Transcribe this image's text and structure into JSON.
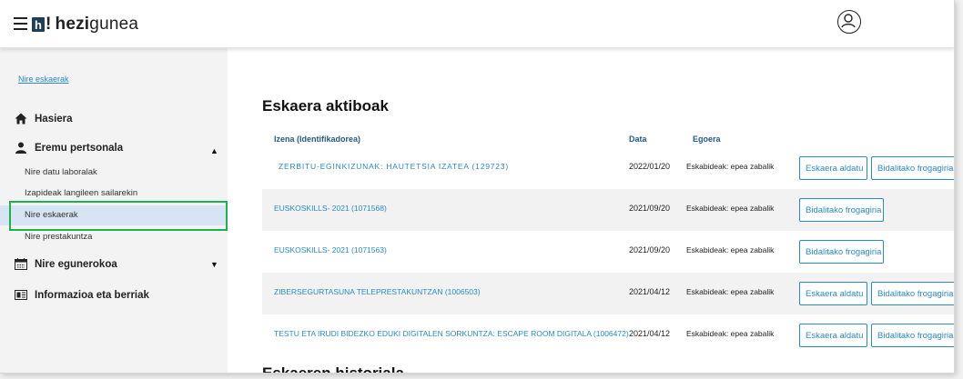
{
  "header": {
    "logo_box": "h",
    "logo_bang": "!",
    "logo_bold": "hezi",
    "logo_light": "gunea"
  },
  "sidebar": {
    "breadcrumb": "Nire eskaerak",
    "home": "Hasiera",
    "personal": "Eremu pertsonala",
    "sub_items": [
      "Nire datu laboralak",
      "Izapideak langileen sailarekin",
      "Nire eskaerak",
      "Nire prestakuntza"
    ],
    "calendar": "Nire egunerokoa",
    "info": "Informazioa eta berriak"
  },
  "main": {
    "active_title": "Eskaera aktiboak",
    "history_title": "Eskaeren historiala",
    "columns": {
      "name": "Izena (Identifikadorea)",
      "date": "Data",
      "status": "Egoera"
    },
    "buttons": {
      "modify": "Eskaera aldatu",
      "receipt": "Bidalitako frogagiria"
    },
    "rows": [
      {
        "name": "ZERBITU-EGINKIZUNAK: HAUTETSIA IZATEA (129723)",
        "date": "2022/01/20",
        "status": "Eskabideak: epea zabalik"
      },
      {
        "name": "EUSKOSKILLS- 2021 (1071568)",
        "date": "2021/09/20",
        "status": "Eskabideak: epea zabalik"
      },
      {
        "name": "EUSKOSKILLS- 2021 (1071563)",
        "date": "2021/09/20",
        "status": "Eskabideak: epea zabalik"
      },
      {
        "name": "ZIBERSEGURTASUNA TELEPRESTAKUNTZAN (1006503)",
        "date": "2021/04/12",
        "status": "Eskabideak: epea zabalik"
      },
      {
        "name": "TESTU ETA IRUDI BIDEZKO EDUKI DIGITALEN SORKUNTZA: ESCAPE ROOM DIGITALA (1006472)",
        "date": "2021/04/12",
        "status": "Eskabideak: epea zabalik"
      }
    ]
  },
  "icons": {
    "menu": "hamburger-icon",
    "user": "user-circle-icon",
    "home": "home-icon",
    "person": "person-icon",
    "calendar": "calendar-icon",
    "news": "newspaper-icon",
    "caret_up": "caret-up-icon",
    "caret_down": "caret-down-icon"
  },
  "colors": {
    "link": "#2a8ac7",
    "header_text": "#245c87",
    "active_item_bg": "#d7e4f3",
    "highlight_border": "#1bb44a",
    "logo_box": "#1f3e58"
  }
}
